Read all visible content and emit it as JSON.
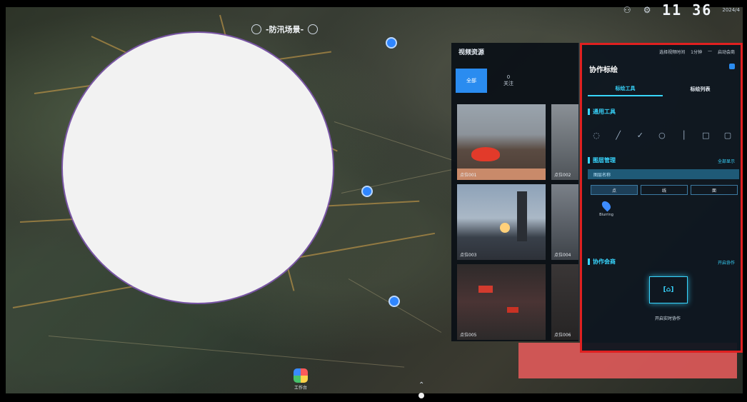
{
  "header": {
    "title": "",
    "scene_label": "-防汛场景-"
  },
  "status_bar": {
    "clock": "11 36",
    "date": "2024/4"
  },
  "video_panel": {
    "title": "视频资源",
    "tabs": [
      {
        "label": "全部"
      },
      {
        "label": "关注",
        "count": "0"
      }
    ],
    "thumbnails": [
      {
        "caption": "点位001"
      },
      {
        "caption": "点位002"
      },
      {
        "caption": "点位003"
      },
      {
        "caption": "点位004"
      },
      {
        "caption": "点位005"
      },
      {
        "caption": "点位006"
      }
    ]
  },
  "collab_panel": {
    "top_items": [
      "选择视频时间",
      "1分钟",
      "—",
      "启动会商"
    ],
    "title": "协作标绘",
    "tabs": [
      "标绘工具",
      "标绘列表"
    ],
    "section_tools": "通用工具",
    "tool_icons": [
      "point-icon",
      "line-icon",
      "check-icon",
      "circle-icon",
      "divider-icon",
      "rect-icon",
      "square-icon"
    ],
    "section_layer": "图层管理",
    "section_layer_link": "全部显示",
    "layer_bar_text": "图层名称",
    "layer_segments": [
      "点",
      "线",
      "面"
    ],
    "layer_item_label": "Blurring",
    "section_cooperate": "协作会商",
    "section_cooperate_link": "开启协作",
    "cooperate_button": "[⌂]",
    "cooperate_label": "开启实时协作"
  },
  "dock": {
    "app_label": "工作台"
  },
  "colors": {
    "accent": "#38d6ff",
    "primary_blue": "#2a8cf0",
    "highlight_red": "#e02020",
    "overlay_red": "#e05a5a"
  }
}
